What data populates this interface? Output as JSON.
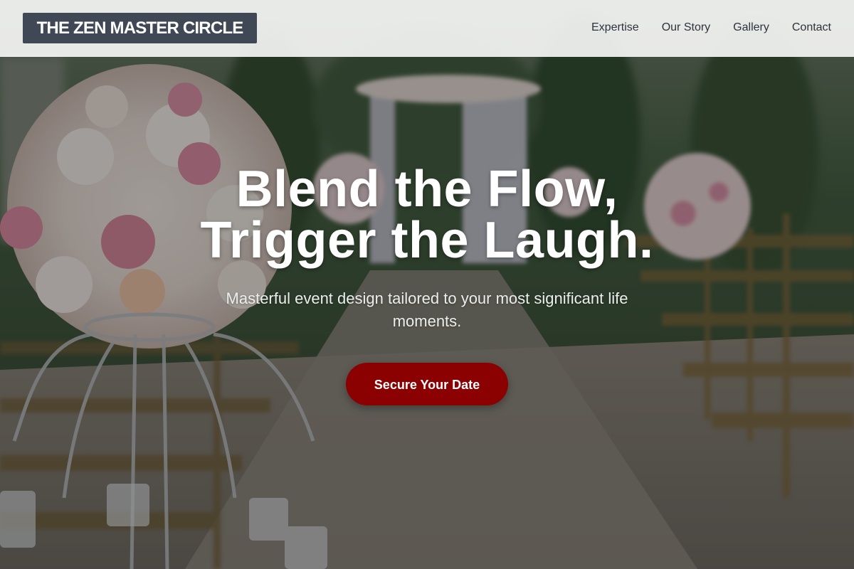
{
  "header": {
    "logo_text": "THE ZEN MASTER CIRCLE",
    "nav": [
      {
        "label": "Expertise"
      },
      {
        "label": "Our Story"
      },
      {
        "label": "Gallery"
      },
      {
        "label": "Contact"
      }
    ]
  },
  "hero": {
    "title_line1": "Blend the Flow,",
    "title_line2": "Trigger the Laugh.",
    "subtitle": "Masterful event design tailored to your most significant life moments.",
    "cta_label": "Secure Your Date"
  },
  "background": {
    "description_icon": "wedding-aisle-photo"
  },
  "colors": {
    "header_bg": "#f4f5f4",
    "logo_bg": "#404856",
    "nav_text": "#2d333b",
    "cta_bg": "#8b0000",
    "hero_text": "#ffffff"
  }
}
